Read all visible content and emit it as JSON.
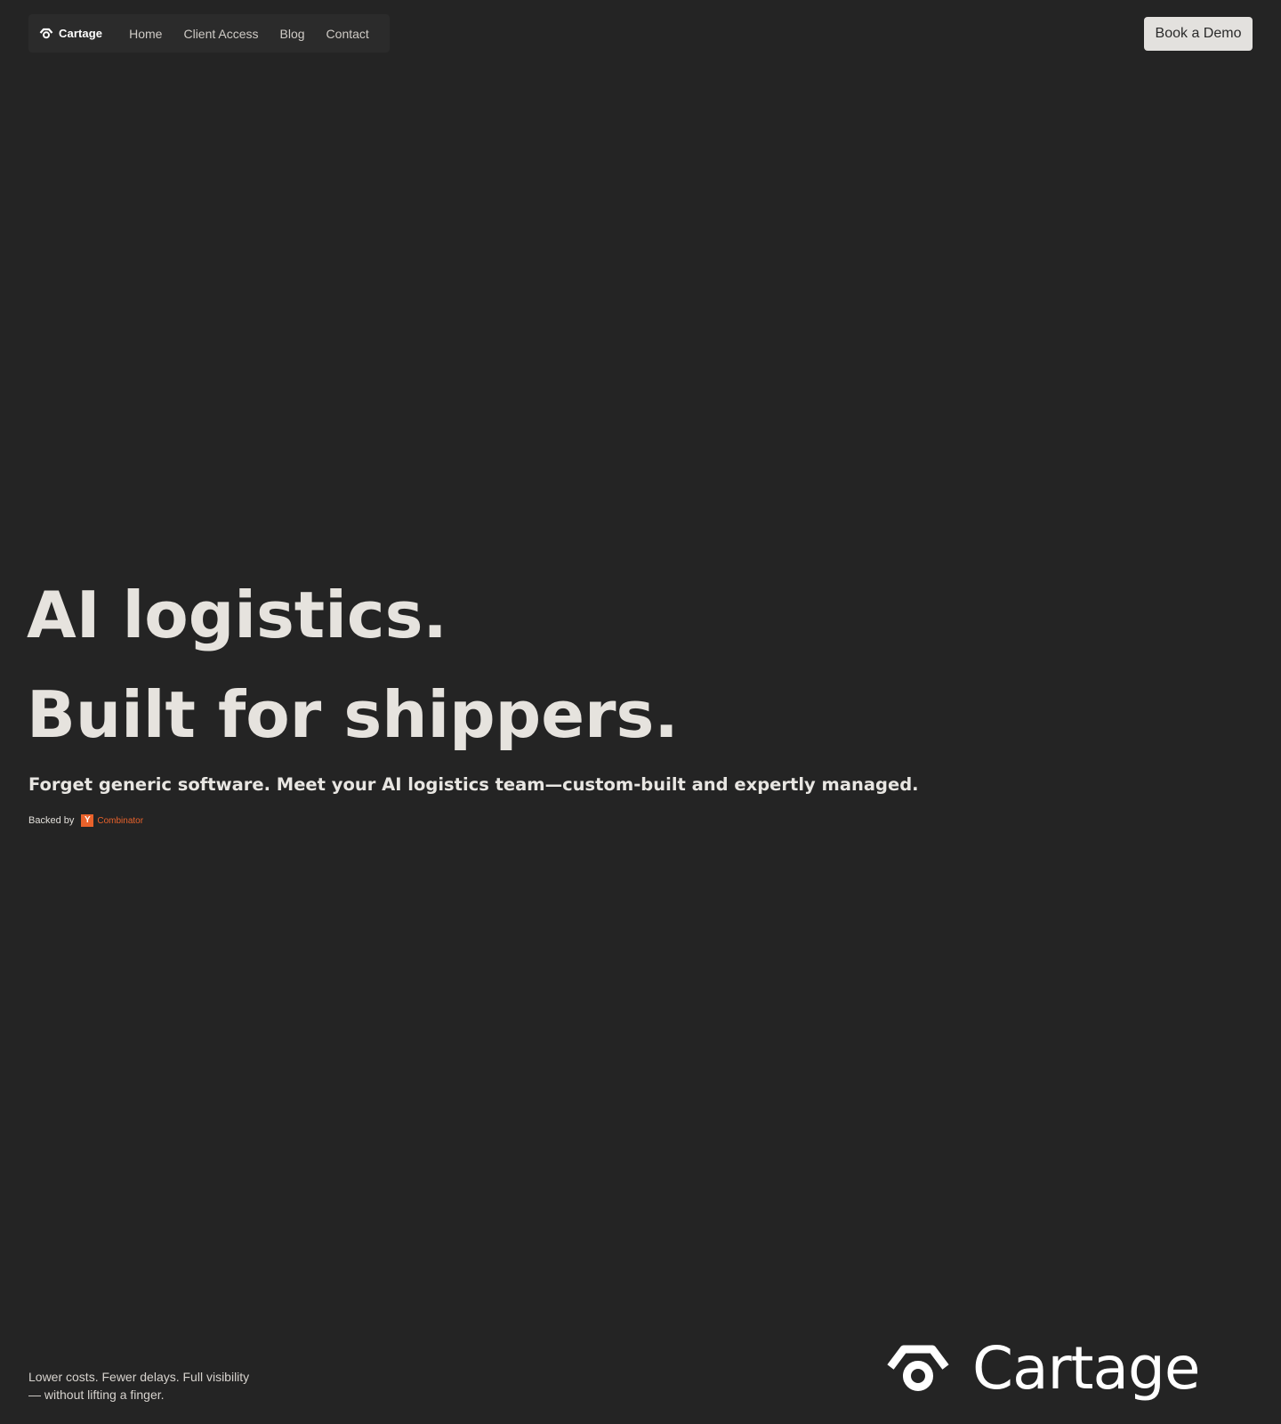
{
  "nav": {
    "brand": "Cartage",
    "links": [
      "Home",
      "Client Access",
      "Blog",
      "Contact"
    ],
    "cta": "Book a Demo"
  },
  "hero": {
    "line1": "AI logistics.",
    "line2": "Built for shippers.",
    "subhead": "Forget generic software. Meet your AI logistics team—custom-built and expertly managed.",
    "backed_label": "Backed by",
    "yc_letter": "Y",
    "yc_text": "Combinator"
  },
  "footer": {
    "tagline_line1": "Lower costs. Fewer delays. Full visibility",
    "tagline_line2": "— without lifting a finger.",
    "logo_text": "Cartage"
  },
  "colors": {
    "background": "#242424",
    "nav_pill": "#2b2b2b",
    "cta_bg": "#e3e1de",
    "accent_yc": "#e9622b"
  },
  "icons": {
    "brand": "cartage-logo-icon"
  }
}
